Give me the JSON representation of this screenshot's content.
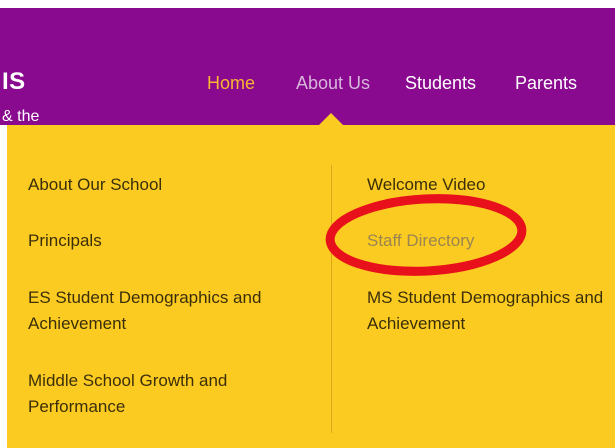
{
  "header": {
    "logo_text": "IS",
    "tagline": "& the"
  },
  "nav": {
    "items": [
      {
        "label": "Home",
        "state": "active"
      },
      {
        "label": "About Us",
        "state": "hover"
      },
      {
        "label": "Students",
        "state": "normal"
      },
      {
        "label": "Parents",
        "state": "normal"
      }
    ]
  },
  "dropdown": {
    "left_column": [
      "About Our School",
      "Principals",
      "ES Student Demographics and Achievement",
      "Middle School Growth and Performance"
    ],
    "right_column": [
      "Welcome Video",
      "Staff Directory",
      "MS Student Demographics and Achievement"
    ]
  },
  "annotation": {
    "type": "circle",
    "target": "Staff Directory",
    "color": "#e8101a"
  },
  "colors": {
    "header_bg": "#8a0a8f",
    "dropdown_bg": "#fccb21",
    "active_nav": "#f7b733",
    "hover_nav": "#d7b6dc",
    "annotation": "#e8101a"
  }
}
